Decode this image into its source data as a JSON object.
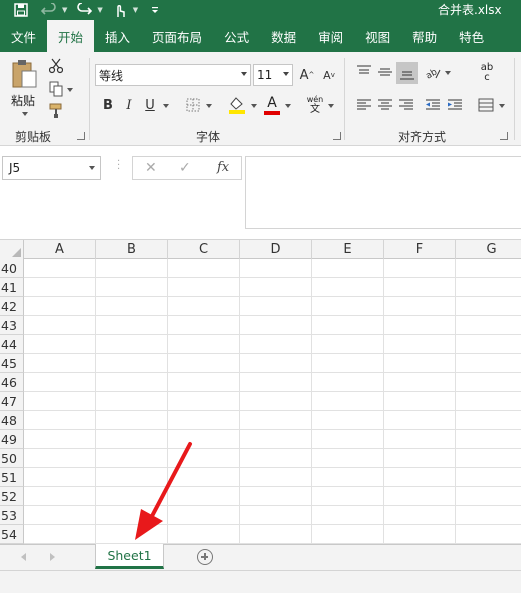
{
  "window": {
    "filename": "合并表.xlsx"
  },
  "ribbon_tabs": [
    "文件",
    "开始",
    "插入",
    "页面布局",
    "公式",
    "数据",
    "审阅",
    "视图",
    "帮助",
    "特色"
  ],
  "active_tab": "开始",
  "clipboard": {
    "paste_label": "粘贴",
    "group_label": "剪贴板"
  },
  "font_group": {
    "font_name": "等线",
    "font_size": "11",
    "group_label": "字体",
    "bold": "B",
    "italic": "I",
    "underline": "U",
    "grow": "A",
    "shrink": "A",
    "wen": "wén",
    "wen_char": "文",
    "font_color_letter": "A"
  },
  "align_group": {
    "group_label": "对齐方式",
    "abc": "ab",
    "abc2": "c"
  },
  "colors": {
    "accent": "#217346",
    "fill_highlight": "#ffe600",
    "font_color": "#e00000"
  },
  "formula_bar": {
    "name_box": "J5",
    "cancel": "✕",
    "enter": "✓",
    "fx": "fx",
    "content": ""
  },
  "columns": [
    "A",
    "B",
    "C",
    "D",
    "E",
    "F",
    "G"
  ],
  "rows": [
    "40",
    "41",
    "42",
    "43",
    "44",
    "45",
    "46",
    "47",
    "48",
    "49",
    "50",
    "51",
    "52",
    "53",
    "54"
  ],
  "sheets": [
    "Sheet1"
  ],
  "annotation": {
    "type": "red-arrow",
    "points_to": "Sheet1"
  }
}
